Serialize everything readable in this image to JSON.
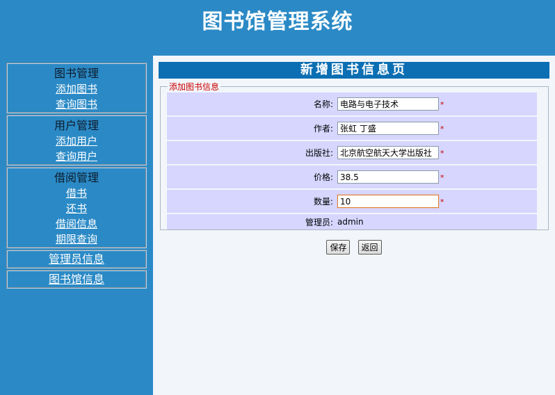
{
  "header": {
    "title": "图书馆管理系统"
  },
  "sidebar": {
    "groups": [
      {
        "title": "图书管理",
        "links": [
          "添加图书",
          "查询图书"
        ]
      },
      {
        "title": "用户管理",
        "links": [
          "添加用户",
          "查询用户"
        ]
      },
      {
        "title": "借阅管理",
        "links": [
          "借书",
          "还书",
          "借阅信息",
          "期限查询"
        ]
      }
    ],
    "single_links": [
      "管理员信息",
      "图书馆信息"
    ]
  },
  "main": {
    "banner": "新增图书信息页",
    "legend": "添加图书信息",
    "required_mark": "*",
    "fields": [
      {
        "label": "名称:",
        "value": "电路与电子技术"
      },
      {
        "label": "作者:",
        "value": "张虹 丁盛"
      },
      {
        "label": "出版社:",
        "value": "北京航空航天大学出版社"
      },
      {
        "label": "价格:",
        "value": "38.5"
      },
      {
        "label": "数量:",
        "value": "10"
      },
      {
        "label": "管理员:",
        "value": "admin"
      }
    ],
    "buttons": {
      "save": "保存",
      "back": "返回"
    }
  }
}
